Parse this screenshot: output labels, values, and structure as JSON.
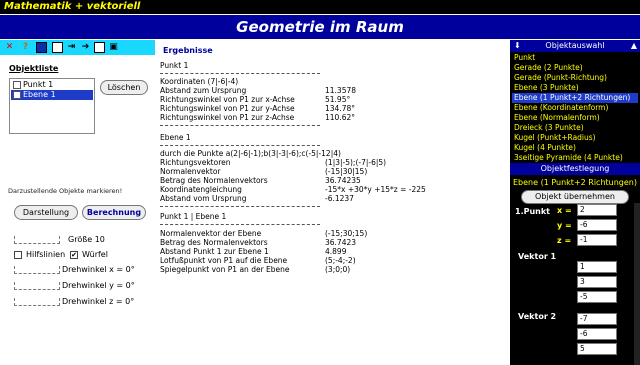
{
  "app_title": "Mathematik + vektoriell",
  "page_title": "Geometrie im Raum",
  "toolbar": {
    "icons": [
      "close-icon",
      "help-icon",
      "save-icon",
      "grid-icon",
      "export-icon",
      "forward-icon",
      "copy-icon",
      "print-icon"
    ]
  },
  "left": {
    "objlist_title": "Objektliste",
    "items": [
      {
        "label": "Punkt 1",
        "checked": false
      },
      {
        "label": "Ebene 1",
        "checked": true
      }
    ],
    "delete_label": "Löschen",
    "hint": "Darzustellende Objekte markieren!",
    "draw_label": "Darstellung",
    "calc_label": "Berechnung",
    "size_label": "Größe 10",
    "helplines_label": "Hilfslinien",
    "cube_label": "Würfel",
    "cube_checked": "✔",
    "rot_x": "Drehwinkel x = 0°",
    "rot_y": "Drehwinkel y = 0°",
    "rot_z": "Drehwinkel z = 0°"
  },
  "results": {
    "title": "Ergebnisse",
    "rows": [
      {
        "label": "Punkt 1",
        "value": ""
      },
      {
        "label": "Koordinaten (7|-6|-4)",
        "value": ""
      },
      {
        "label": "Abstand zum Ursprung",
        "value": "11.3578"
      },
      {
        "label": "Richtungswinkel von P1 zur x-Achse",
        "value": "51.95°"
      },
      {
        "label": "Richtungswinkel von P1 zur y-Achse",
        "value": "134.78°"
      },
      {
        "label": "Richtungswinkel von P1 zur z-Achse",
        "value": "110.62°"
      },
      {
        "label": "Ebene 1",
        "value": ""
      },
      {
        "label": "durch die Punkte a(2|-6|-1);b(3|-3|-6);c(-5|-12|4)",
        "value": ""
      },
      {
        "label": "Richtungsvektoren",
        "value": "(1|3|-5);(-7|-6|5)"
      },
      {
        "label": "Normalenvektor",
        "value": "(-15|30|15)"
      },
      {
        "label": "Betrag des Normalenvektors",
        "value": "36.74235"
      },
      {
        "label": "Koordinatengleichung",
        "value": "-15*x +30*y +15*z = -225"
      },
      {
        "label": "Abstand vom Ursprung",
        "value": "-6.1237"
      },
      {
        "label": "Punkt 1 | Ebene 1",
        "value": ""
      },
      {
        "label": "Normalenvektor der Ebene",
        "value": "(-15;30;15)"
      },
      {
        "label": "Betrag des Normalenvektors",
        "value": "36.7423"
      },
      {
        "label": "Abstand Punkt 1 zur Ebene 1",
        "value": "4.899"
      },
      {
        "label": "Lotfußpunkt von P1 auf die Ebene",
        "value": "(5;-4;-2)"
      },
      {
        "label": "Spiegelpunkt von P1 an der Ebene",
        "value": "(3;0;0)"
      }
    ]
  },
  "right": {
    "selection_header": "Objektauswahl",
    "selection_items": [
      "Punkt",
      "Gerade (2 Punkte)",
      "Gerade (Punkt-Richtung)",
      "Ebene (3 Punkte)",
      "Ebene (1 Punkt+2 Richtungen)",
      "Ebene (Koordinatenform)",
      "Ebene (Normalenform)",
      "Dreieck (3 Punkte)",
      "Kugel (Punkt+Radius)",
      "Kugel (4 Punkte)",
      "3seitige Pyramide (4 Punkte)"
    ],
    "active_index": 4,
    "spec_header": "Objektfestlegung",
    "spec_object": "Ebene (1 Punkt+2 Richtungen)",
    "apply_label": "Objekt übernehmen",
    "point_label": "1.Punkt",
    "x_label": "x =",
    "y_label": "y =",
    "z_label": "z =",
    "x_value": "2",
    "y_value": "-6",
    "z_value": "-1",
    "vec1_label": "Vektor 1",
    "vec1": [
      "1",
      "3",
      "-5"
    ],
    "vec2_label": "Vektor 2",
    "vec2": [
      "-7",
      "-6",
      "5"
    ]
  },
  "colors": {
    "title_yellow": "#ffff00",
    "banner_blue": "#00009c",
    "toolbar_cyan": "#19d8ff",
    "selection_blue": "#1e3cc8"
  }
}
